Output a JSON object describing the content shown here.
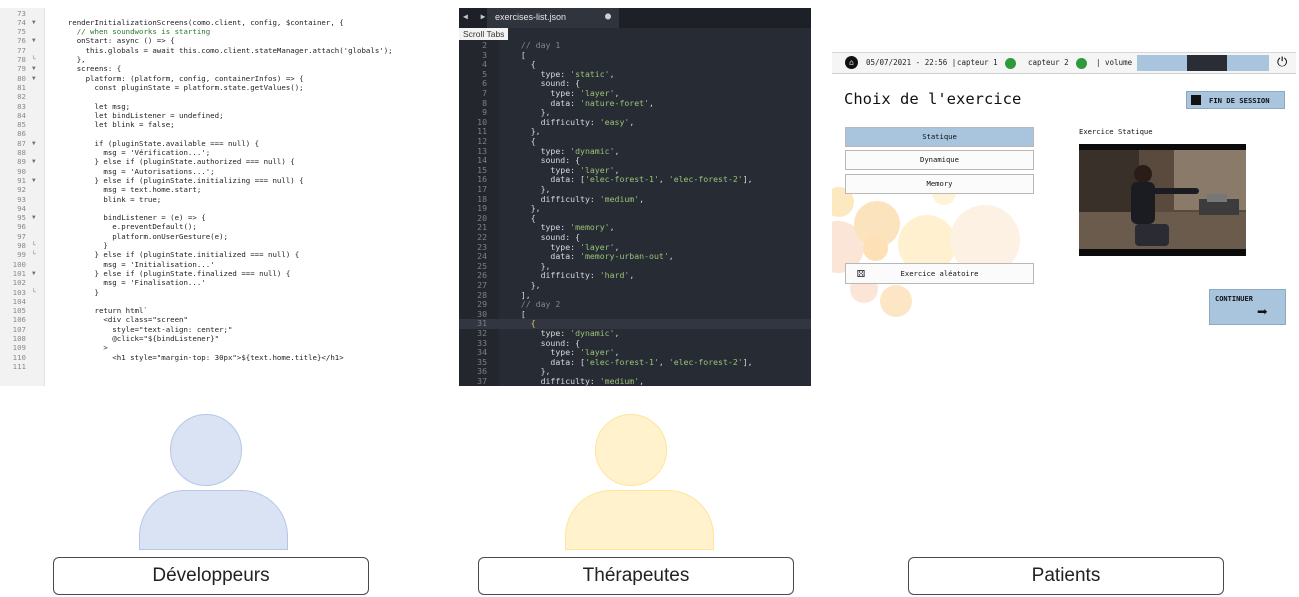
{
  "dev_editor": {
    "lines": [
      {
        "n": "73",
        "f": "",
        "t": ""
      },
      {
        "n": "74",
        "f": "▼",
        "t": "    renderInitializationScreens(como.client, config, $container, {"
      },
      {
        "n": "75",
        "f": "",
        "t": "      // when soundworks is starting"
      },
      {
        "n": "76",
        "f": "▼",
        "t": "      onStart: async () => {"
      },
      {
        "n": "77",
        "f": "",
        "t": "        this.globals = await this.como.client.stateManager.attach('globals');"
      },
      {
        "n": "78",
        "f": "└",
        "t": "      },"
      },
      {
        "n": "79",
        "f": "▼",
        "t": "      screens: {"
      },
      {
        "n": "80",
        "f": "▼",
        "t": "        platform: (platform, config, containerInfos) => {"
      },
      {
        "n": "81",
        "f": "",
        "t": "          const pluginState = platform.state.getValues();"
      },
      {
        "n": "82",
        "f": "",
        "t": ""
      },
      {
        "n": "83",
        "f": "",
        "t": "          let msg;"
      },
      {
        "n": "84",
        "f": "",
        "t": "          let bindListener = undefined;"
      },
      {
        "n": "85",
        "f": "",
        "t": "          let blink = false;"
      },
      {
        "n": "86",
        "f": "",
        "t": ""
      },
      {
        "n": "87",
        "f": "▼",
        "t": "          if (pluginState.available === null) {"
      },
      {
        "n": "88",
        "f": "",
        "t": "            msg = 'Vérification...';"
      },
      {
        "n": "89",
        "f": "▼",
        "t": "          } else if (pluginState.authorized === null) {"
      },
      {
        "n": "90",
        "f": "",
        "t": "            msg = 'Autorisations...';"
      },
      {
        "n": "91",
        "f": "▼",
        "t": "          } else if (pluginState.initializing === null) {"
      },
      {
        "n": "92",
        "f": "",
        "t": "            msg = text.home.start;"
      },
      {
        "n": "93",
        "f": "",
        "t": "            blink = true;"
      },
      {
        "n": "94",
        "f": "",
        "t": ""
      },
      {
        "n": "95",
        "f": "▼",
        "t": "            bindListener = (e) => {"
      },
      {
        "n": "96",
        "f": "",
        "t": "              e.preventDefault();"
      },
      {
        "n": "97",
        "f": "",
        "t": "              platform.onUserGesture(e);"
      },
      {
        "n": "98",
        "f": "└",
        "t": "            }"
      },
      {
        "n": "99",
        "f": "└",
        "t": "          } else if (pluginState.initialized === null) {"
      },
      {
        "n": "100",
        "f": "",
        "t": "            msg = 'Initialisation...'"
      },
      {
        "n": "101",
        "f": "▼",
        "t": "          } else if (pluginState.finalized === null) {"
      },
      {
        "n": "102",
        "f": "",
        "t": "            msg = 'Finalisation...'"
      },
      {
        "n": "103",
        "f": "└",
        "t": "          }"
      },
      {
        "n": "104",
        "f": "",
        "t": ""
      },
      {
        "n": "105",
        "f": "",
        "t": "          return html`"
      },
      {
        "n": "106",
        "f": "",
        "t": "            <div class=\"screen\""
      },
      {
        "n": "107",
        "f": "",
        "t": "              style=\"text-align: center;\""
      },
      {
        "n": "108",
        "f": "",
        "t": "              @click=\"${bindListener}\""
      },
      {
        "n": "109",
        "f": "",
        "t": "            >"
      },
      {
        "n": "110",
        "f": "",
        "t": "              <h1 style=\"margin-top: 30px\">${text.home.title}</h1>"
      },
      {
        "n": "111",
        "f": "",
        "t": ""
      }
    ]
  },
  "json_editor": {
    "nav_arrows": "◀ ▶",
    "tab_title": "exercises-list.json",
    "tab_dot": "●",
    "scroll_tabs": "Scroll Tabs",
    "current_line": "31",
    "lines": [
      {
        "n": "2",
        "t": "  // day 1"
      },
      {
        "n": "3",
        "t": "  ["
      },
      {
        "n": "4",
        "t": "    {"
      },
      {
        "n": "5",
        "t": "      type: 'static',"
      },
      {
        "n": "6",
        "t": "      sound: {"
      },
      {
        "n": "7",
        "t": "        type: 'layer',"
      },
      {
        "n": "8",
        "t": "        data: 'nature-foret',"
      },
      {
        "n": "9",
        "t": "      },"
      },
      {
        "n": "10",
        "t": "      difficulty: 'easy',"
      },
      {
        "n": "11",
        "t": "    },"
      },
      {
        "n": "12",
        "t": "    {"
      },
      {
        "n": "13",
        "t": "      type: 'dynamic',"
      },
      {
        "n": "14",
        "t": "      sound: {"
      },
      {
        "n": "15",
        "t": "        type: 'layer',"
      },
      {
        "n": "16",
        "t": "        data: ['elec-forest-1', 'elec-forest-2'],"
      },
      {
        "n": "17",
        "t": "      },"
      },
      {
        "n": "18",
        "t": "      difficulty: 'medium',"
      },
      {
        "n": "19",
        "t": "    },"
      },
      {
        "n": "20",
        "t": "    {"
      },
      {
        "n": "21",
        "t": "      type: 'memory',"
      },
      {
        "n": "22",
        "t": "      sound: {"
      },
      {
        "n": "23",
        "t": "        type: 'layer',"
      },
      {
        "n": "24",
        "t": "        data: 'memory-urban-out',"
      },
      {
        "n": "25",
        "t": "      },"
      },
      {
        "n": "26",
        "t": "      difficulty: 'hard',"
      },
      {
        "n": "27",
        "t": "    },"
      },
      {
        "n": "28",
        "t": "  ],"
      },
      {
        "n": "29",
        "t": "  // day 2"
      },
      {
        "n": "30",
        "t": "  ["
      },
      {
        "n": "31",
        "t": "    {"
      },
      {
        "n": "32",
        "t": "      type: 'dynamic',"
      },
      {
        "n": "33",
        "t": "      sound: {"
      },
      {
        "n": "34",
        "t": "        type: 'layer',"
      },
      {
        "n": "35",
        "t": "        data: ['elec-forest-1', 'elec-forest-2'],"
      },
      {
        "n": "36",
        "t": "      },"
      },
      {
        "n": "37",
        "t": "      difficulty: 'medium',"
      }
    ]
  },
  "patient_app": {
    "datetime": "05/07/2021 - 22:56 |",
    "sensor1": "capteur 1",
    "sensor2": "capteur 2",
    "volume": "| volume",
    "sensor_color": "#2f9a3b",
    "accent": "#a9c4dd",
    "title": "Choix de l'exercice",
    "end_session": "FIN DE SESSION",
    "exercises": [
      "Statique",
      "Dynamique",
      "Memory"
    ],
    "selected_exercise": "Statique",
    "random_exercise": "Exercice aléatoire",
    "preview_label": "Exercice Statique",
    "continue": "CONTINUER"
  },
  "personas": [
    {
      "label": "Développeurs",
      "color": "#dae3f3",
      "stroke": "#b4c7e7"
    },
    {
      "label": "Thérapeutes",
      "color": "#fbe5d6",
      "stroke": "#f4c9ab"
    },
    {
      "label": "Patients",
      "color": "#fff2cc",
      "stroke": "#ffe49a"
    }
  ]
}
